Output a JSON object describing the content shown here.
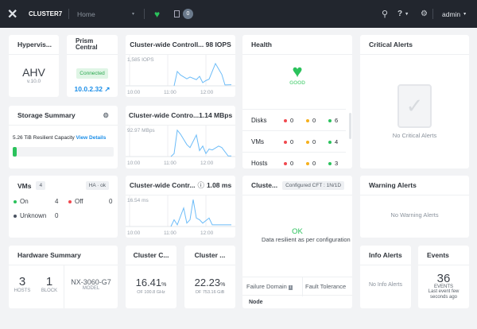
{
  "topbar": {
    "cluster": "CLUSTER7",
    "page": "Home",
    "task_count": "0",
    "user": "admin",
    "icons": [
      "nutanix-x-logo",
      "health-heart-icon",
      "tasks-icon",
      "search-icon",
      "help-icon",
      "gear-icon"
    ]
  },
  "hypervisor": {
    "title": "Hypervis...",
    "name": "AHV",
    "version": "v.10.0"
  },
  "prism": {
    "title": "Prism Central",
    "status": "Connected",
    "ip": "10.0.2.32 ↗"
  },
  "iops": {
    "title": "Cluster-wide Controll... 98 IOPS",
    "max_label": "1,585 IOPS",
    "x_labels": [
      "10:00",
      "11:00",
      "12:00"
    ]
  },
  "bw": {
    "title": "Cluster-wide Contro...1.14 MBps",
    "max_label": "92.97 MBps",
    "x_labels": [
      "10:00",
      "11:00",
      "12:00"
    ]
  },
  "lat": {
    "title": "Cluster-wide Contr...",
    "value": "1.08 ms",
    "max_label": "16.54 ms",
    "x_labels": [
      "10:00",
      "11:00",
      "12:00"
    ]
  },
  "chart_data": [
    {
      "type": "line",
      "name": "iops",
      "ylim": [
        0,
        1585
      ],
      "x": [
        "11:10",
        "11:15",
        "11:20",
        "11:30",
        "11:35",
        "11:45",
        "11:50",
        "11:55",
        "12:00",
        "12:05",
        "12:15",
        "12:25",
        "12:30",
        "12:40"
      ],
      "values": [
        0,
        820,
        620,
        400,
        500,
        350,
        540,
        180,
        300,
        380,
        1270,
        650,
        50,
        60
      ]
    },
    {
      "type": "line",
      "name": "bw",
      "ylim": [
        0,
        92.97
      ],
      "x": [
        "11:05",
        "11:10",
        "11:15",
        "11:20",
        "11:30",
        "11:35",
        "11:45",
        "11:50",
        "11:55",
        "12:00",
        "12:05",
        "12:10",
        "12:20",
        "12:25",
        "12:35",
        "12:40"
      ],
      "values": [
        0,
        10,
        88,
        75,
        40,
        30,
        72,
        20,
        35,
        10,
        25,
        22,
        35,
        30,
        2,
        2
      ]
    },
    {
      "type": "line",
      "name": "lat",
      "ylim": [
        0,
        16.54
      ],
      "x": [
        "11:05",
        "11:10",
        "11:15",
        "11:25",
        "11:30",
        "11:35",
        "11:40",
        "11:45",
        "11:50",
        "11:55",
        "12:05",
        "12:10",
        "12:20",
        "12:40"
      ],
      "values": [
        0,
        4,
        1,
        11,
        2,
        4,
        16,
        5,
        4,
        2,
        5,
        1,
        1,
        1
      ]
    }
  ],
  "storage": {
    "title": "Storage Summary",
    "capacity": "5.26 TiB",
    "capacity_label": "Resilient Capacity",
    "link": "View Details",
    "used_fraction": 0.03
  },
  "health": {
    "title": "Health",
    "status": "GOOD",
    "rows": [
      {
        "label": "Disks",
        "red": "0",
        "yellow": "0",
        "green": "6"
      },
      {
        "label": "VMs",
        "red": "0",
        "yellow": "0",
        "green": "4"
      },
      {
        "label": "Hosts",
        "red": "0",
        "yellow": "0",
        "green": "3"
      }
    ]
  },
  "critical": {
    "title": "Critical Alerts",
    "empty": "No Critical Alerts"
  },
  "vms": {
    "title": "VMs",
    "count": "4",
    "ha": "HA · ok",
    "on_label": "On",
    "on": "4",
    "off_label": "Off",
    "off": "0",
    "unknown_label": "Unknown",
    "unknown": "0"
  },
  "hardware": {
    "title": "Hardware Summary",
    "hosts": "3",
    "hosts_label": "HOSTS",
    "blocks": "1",
    "blocks_label": "BLOCK",
    "model": "NX-3060-G7",
    "model_label": "MODEL"
  },
  "cpu": {
    "title": "Cluster C...",
    "value": "16.41",
    "unit": "%",
    "of": "OF 100.8 GHz"
  },
  "mem": {
    "title": "Cluster ...",
    "value": "22.23",
    "unit": "%",
    "of": "OF 753.16 GiB"
  },
  "resiliency": {
    "title": "Cluste...",
    "cft": "Configured CFT : 1N/1D",
    "status": "OK",
    "desc": "Data resilient as per configuration",
    "col1": "Failure Domain",
    "col2": "Fault Tolerance",
    "row": "Node"
  },
  "warning": {
    "title": "Warning Alerts",
    "empty": "No Warning Alerts"
  },
  "info": {
    "title": "Info Alerts",
    "empty": "No Info Alerts"
  },
  "events": {
    "title": "Events",
    "count": "36",
    "label": "EVENTS",
    "sub": "Last event few seconds ago"
  },
  "colors": {
    "topbar": "#22262e",
    "accent": "#1b8ee8",
    "good": "#2bc25c",
    "red": "#f0494f",
    "yellow": "#f6b01b",
    "line": "#6cbcf8"
  }
}
